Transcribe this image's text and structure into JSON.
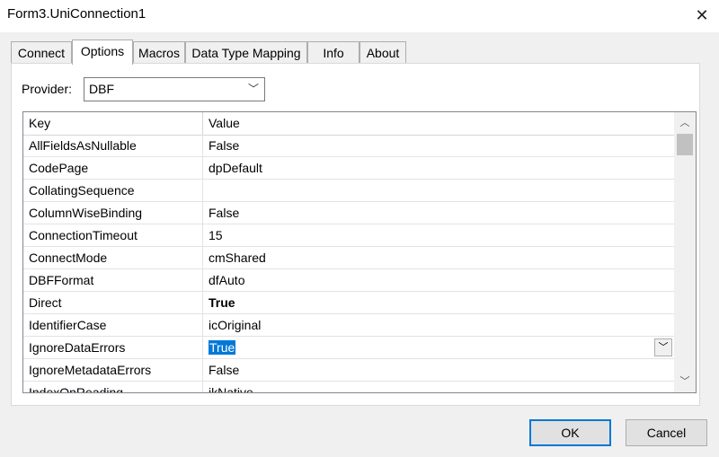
{
  "window": {
    "title": "Form3.UniConnection1",
    "close_glyph": "✕"
  },
  "tabs": [
    {
      "label": "Connect"
    },
    {
      "label": "Options",
      "active": true
    },
    {
      "label": "Macros"
    },
    {
      "label": "Data Type Mapping"
    },
    {
      "label": "Info"
    },
    {
      "label": "About"
    }
  ],
  "provider": {
    "label": "Provider:",
    "value": "DBF"
  },
  "grid": {
    "headers": {
      "key": "Key",
      "value": "Value"
    },
    "rows": [
      {
        "key": "AllFieldsAsNullable",
        "value": "False"
      },
      {
        "key": "CodePage",
        "value": "dpDefault"
      },
      {
        "key": "CollatingSequence",
        "value": ""
      },
      {
        "key": "ColumnWiseBinding",
        "value": "False"
      },
      {
        "key": "ConnectionTimeout",
        "value": "15"
      },
      {
        "key": "ConnectMode",
        "value": "cmShared"
      },
      {
        "key": "DBFFormat",
        "value": "dfAuto"
      },
      {
        "key": "Direct",
        "value": "True",
        "bold": true
      },
      {
        "key": "IdentifierCase",
        "value": "icOriginal"
      },
      {
        "key": "IgnoreDataErrors",
        "value": "True",
        "selected": true
      },
      {
        "key": "IgnoreMetadataErrors",
        "value": "False"
      },
      {
        "key": "IndexOnReading",
        "value": "ikNative"
      }
    ]
  },
  "buttons": {
    "ok": "OK",
    "cancel": "Cancel"
  },
  "icons": {
    "dropdown": "chevron-down-icon",
    "scroll_up": "chevron-up-icon",
    "scroll_down": "chevron-down-icon",
    "close": "close-icon"
  }
}
